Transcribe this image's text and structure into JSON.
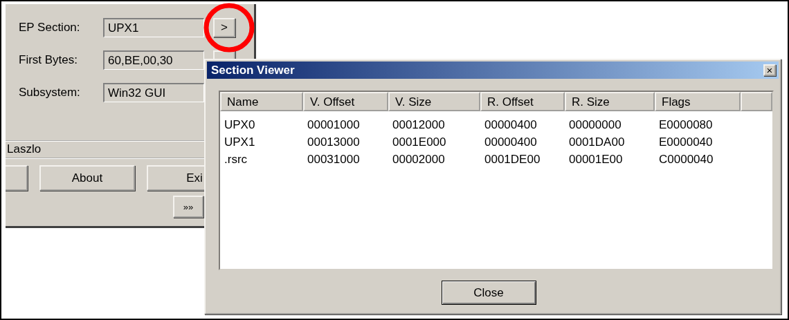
{
  "main_window": {
    "fields": [
      {
        "label": "EP Section:",
        "value": "UPX1",
        "button": ">"
      },
      {
        "label": "First Bytes:",
        "value": "60,BE,00,30"
      },
      {
        "label": "Subsystem:",
        "value": "Win32 GUI"
      }
    ],
    "status_text": "Laszlo",
    "buttons": [
      "About",
      "Exi"
    ],
    "more_button": "»»"
  },
  "dialog": {
    "title": "Section Viewer",
    "close_glyph": "×",
    "columns": [
      "Name",
      "V. Offset",
      "V. Size",
      "R. Offset",
      "R. Size",
      "Flags"
    ],
    "rows": [
      [
        "UPX0",
        "00001000",
        "00012000",
        "00000400",
        "00000000",
        "E0000080"
      ],
      [
        "UPX1",
        "00013000",
        "0001E000",
        "00000400",
        "0001DA00",
        "E0000040"
      ],
      [
        ".rsrc",
        "00031000",
        "00002000",
        "0001DE00",
        "00001E00",
        "C0000040"
      ]
    ],
    "close_button": "Close"
  }
}
